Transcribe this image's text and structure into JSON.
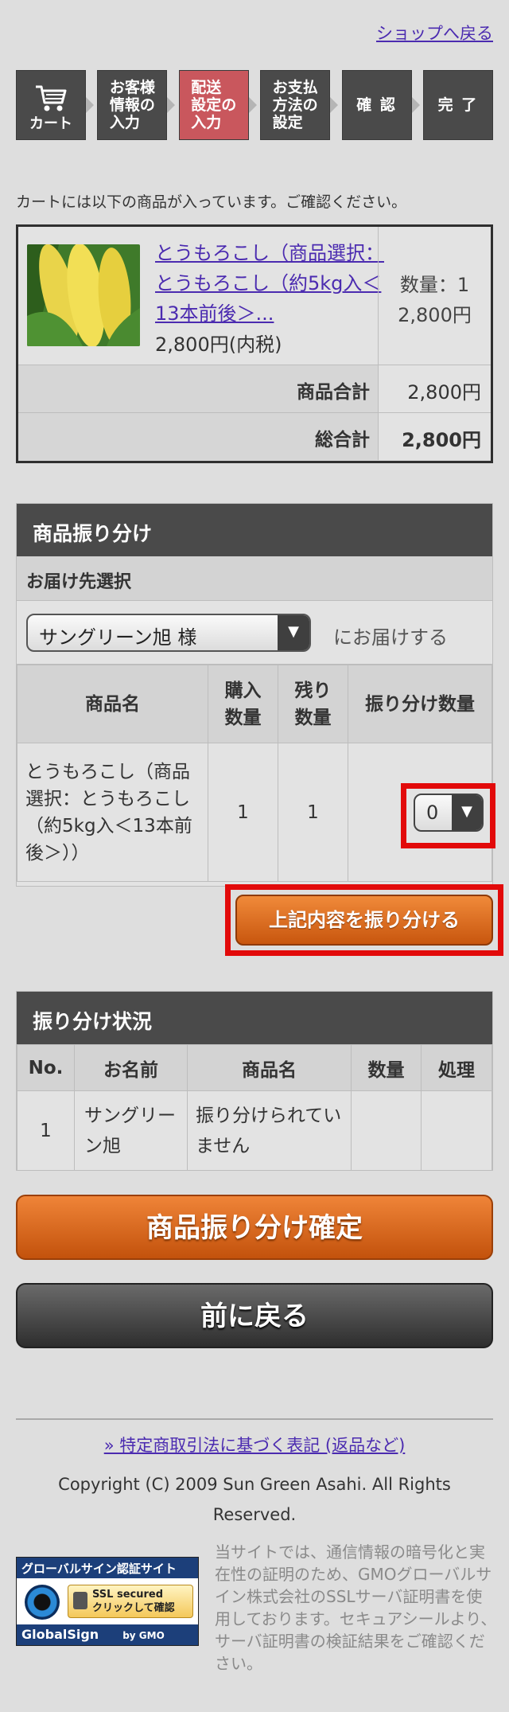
{
  "header": {
    "shop_back": "ショップへ戻る"
  },
  "steps": [
    {
      "label": "カート",
      "icon": "cart-icon"
    },
    {
      "label": "お客様\n情報の\n入力"
    },
    {
      "label": "配送\n設定の\n入力",
      "active": true
    },
    {
      "label": "お支払\n方法の\n設定"
    },
    {
      "label": "確 認"
    },
    {
      "label": "完 了"
    }
  ],
  "intro_text": "カートには以下の商品が入っています。ご確認ください。",
  "cart": {
    "item_name": "とうもろこし（商品選択：とうもろこし（約5kg入＜13本前後＞...",
    "item_price": "2,800円(内税)",
    "quantity": "数量：1",
    "line_total": "2,800円",
    "subtotal_label": "商品合計",
    "subtotal_value": "2,800円",
    "total_label": "総合計",
    "total_value": "2,800円"
  },
  "distribution": {
    "section_title": "商品振り分け",
    "dest_heading": "お届け先選択",
    "dest_selected": "サングリーン旭 様",
    "dest_suffix": "にお届けする",
    "table_headers": {
      "name": "商品名",
      "purchased": "購入\n数量",
      "remaining": "残り\n数量",
      "assign": "振り分け数量"
    },
    "row": {
      "name": "とうもろこし（商品選択：とうもろこし（約5kg入＜13本前後＞））",
      "purchased": "1",
      "remaining": "1",
      "assign_value": "0"
    },
    "apply_button": "上記内容を振り分ける"
  },
  "status": {
    "section_title": "振り分け状況",
    "headers": {
      "no": "No.",
      "name": "お名前",
      "product": "商品名",
      "qty": "数量",
      "action": "処理"
    },
    "row": {
      "no": "1",
      "name": "サングリーン旭",
      "product": "振り分けられていません",
      "qty": "",
      "action": ""
    }
  },
  "buttons": {
    "confirm": "商品振り分け確定",
    "back": "前に戻る"
  },
  "footer": {
    "legal_link": "» 特定商取引法に基づく表記 (返品など)",
    "copyright": "Copyright (C) 2009 Sun Green Asahi. All Rights Reserved.",
    "seal": {
      "top": "グローバルサイン認証サイト",
      "ssl_line1": "SSL secured",
      "ssl_line2": "クリックして確認",
      "brand": "GlobalSign",
      "by": "by GMO"
    },
    "seal_note": "当サイトでは、通信情報の暗号化と実在性の証明のため、GMOグローバルサイン株式会社のSSLサーバ証明書を使用しております。セキュアシールより、サーバ証明書の検証結果をご確認ください。"
  },
  "colors": {
    "accent_orange": "#d8651e",
    "active_step": "#c9575d",
    "dark": "#4a4a4a",
    "highlight": "#e20a0a"
  }
}
